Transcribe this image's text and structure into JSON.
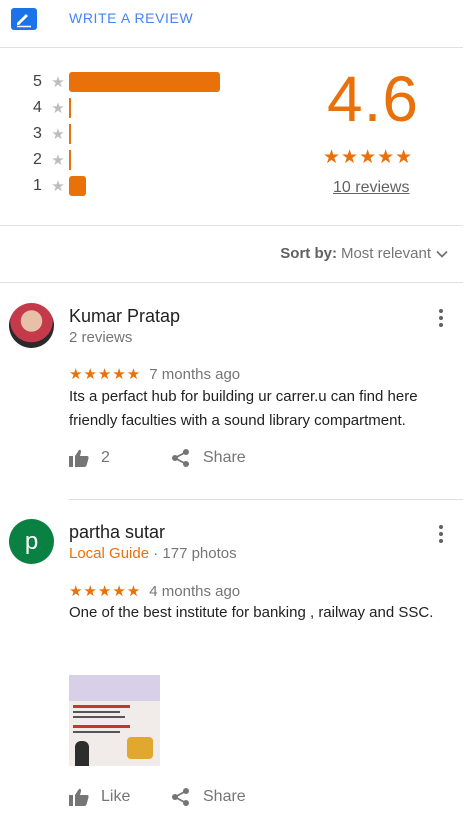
{
  "write_review": {
    "label": "WRITE A REVIEW"
  },
  "summary": {
    "histogram": [
      {
        "stars": "5",
        "fraction": 0.8
      },
      {
        "stars": "4",
        "fraction": 0.0
      },
      {
        "stars": "3",
        "fraction": 0.0
      },
      {
        "stars": "2",
        "fraction": 0.0
      },
      {
        "stars": "1",
        "fraction": 0.1
      }
    ],
    "average": "4.6",
    "average_stars": "★★★★★",
    "reviews_link": "10 reviews"
  },
  "sort": {
    "label": "Sort by:",
    "value": "Most relevant"
  },
  "reviews": [
    {
      "author": "Kumar Pratap",
      "meta": "2 reviews",
      "stars": "★★★★★",
      "time": "7 months ago",
      "text": "Its a perfact hub for building ur carrer.u can find here friendly faculties with a sound library compartment.",
      "likes": "2",
      "share": "Share"
    },
    {
      "author": "partha sutar",
      "avatar_letter": "p",
      "guide": "Local Guide",
      "photos": "· 177 photos",
      "stars": "★★★★★",
      "time": "4 months ago",
      "text": "One of the best institute for banking , railway and SSC.",
      "like_label": "Like",
      "share": "Share"
    }
  ],
  "colors": {
    "accent": "#e8710a",
    "link": "#4285f4",
    "avatar_green": "#0b8043"
  }
}
